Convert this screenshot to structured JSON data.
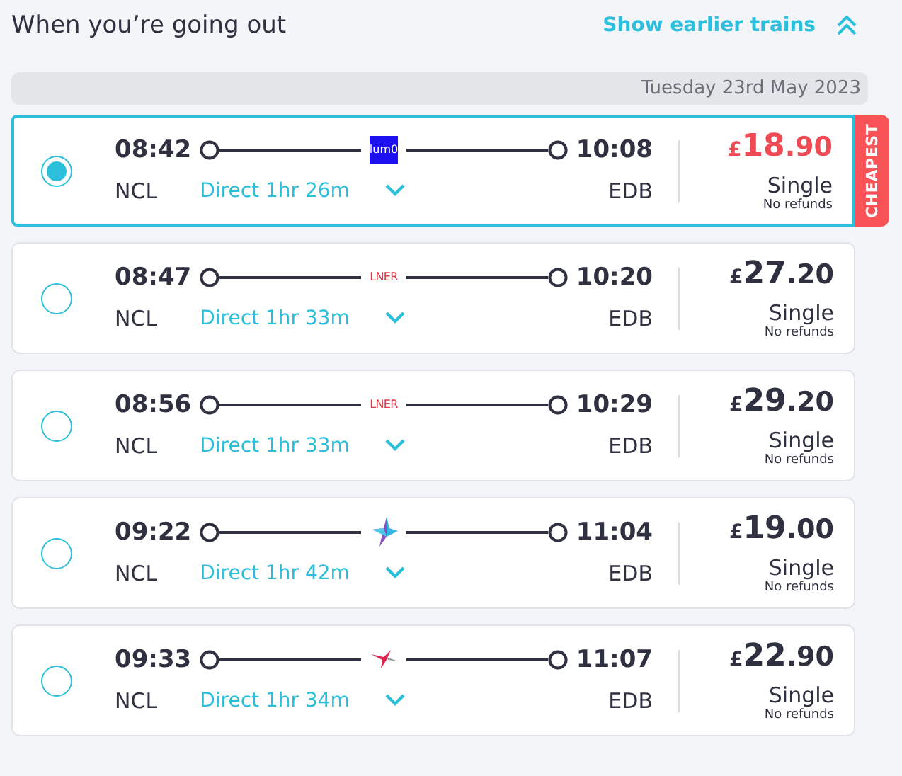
{
  "header": {
    "title": "When you’re going out",
    "earlier_link": "Show earlier trains"
  },
  "date_bar": "Tuesday 23rd May 2023",
  "journeys": [
    {
      "selected": true,
      "cheapest": true,
      "badge": "CHEAPEST",
      "depart": "08:42",
      "arrive": "10:08",
      "from": "NCL",
      "to": "EDB",
      "duration": "Direct 1hr 26m",
      "operator": {
        "kind": "square",
        "label": "lum0"
      },
      "price": {
        "currency": "£",
        "whole": "18",
        "fraction": ".90"
      },
      "ticket": "Single",
      "conditions": "No refunds"
    },
    {
      "selected": false,
      "cheapest": false,
      "depart": "08:47",
      "arrive": "10:20",
      "from": "NCL",
      "to": "EDB",
      "duration": "Direct 1hr 33m",
      "operator": {
        "kind": "wordmark",
        "label": "LNER"
      },
      "price": {
        "currency": "£",
        "whole": "27",
        "fraction": ".20"
      },
      "ticket": "Single",
      "conditions": "No refunds"
    },
    {
      "selected": false,
      "cheapest": false,
      "depart": "08:56",
      "arrive": "10:29",
      "from": "NCL",
      "to": "EDB",
      "duration": "Direct 1hr 33m",
      "operator": {
        "kind": "wordmark",
        "label": "LNER"
      },
      "price": {
        "currency": "£",
        "whole": "29",
        "fraction": ".20"
      },
      "ticket": "Single",
      "conditions": "No refunds"
    },
    {
      "selected": false,
      "cheapest": false,
      "depart": "09:22",
      "arrive": "11:04",
      "from": "NCL",
      "to": "EDB",
      "duration": "Direct 1hr 42m",
      "operator": {
        "kind": "star"
      },
      "price": {
        "currency": "£",
        "whole": "19",
        "fraction": ".00"
      },
      "ticket": "Single",
      "conditions": "No refunds"
    },
    {
      "selected": false,
      "cheapest": false,
      "depart": "09:33",
      "arrive": "11:07",
      "from": "NCL",
      "to": "EDB",
      "duration": "Direct 1hr 34m",
      "operator": {
        "kind": "bird"
      },
      "price": {
        "currency": "£",
        "whole": "22",
        "fraction": ".90"
      },
      "ticket": "Single",
      "conditions": "No refunds"
    }
  ]
}
